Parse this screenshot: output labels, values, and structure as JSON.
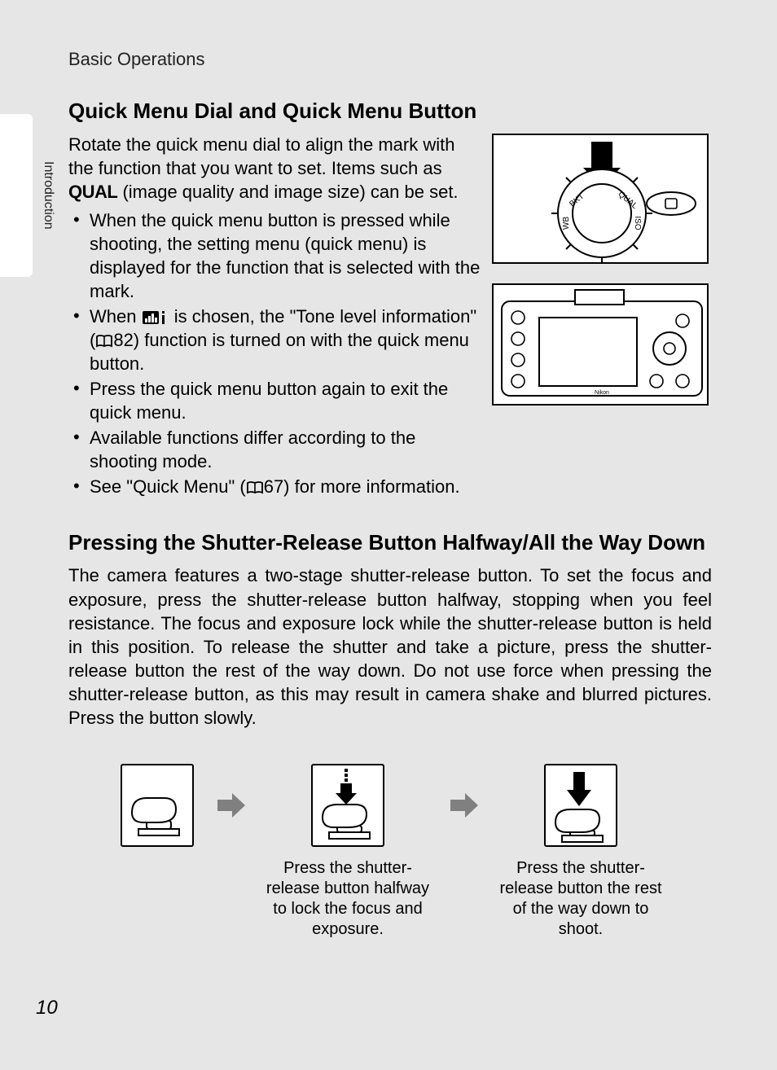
{
  "header": {
    "title": "Basic Operations"
  },
  "sideTab": {
    "label": "Introduction"
  },
  "section1": {
    "heading": "Quick Menu Dial and Quick Menu Button",
    "intro_a": "Rotate the quick menu dial to align the mark with the function that you want to set. Items such as ",
    "intro_qual": "QUAL",
    "intro_b": " (image quality and image size) can be set.",
    "bullets": {
      "b1": "When the quick menu button is pressed while shooting, the setting menu (quick menu) is displayed for the function that is selected with the mark.",
      "b2_a": "When ",
      "b2_b": " is chosen, the \"Tone level information\" (",
      "b2_c": "82) function is turned on with the quick menu button.",
      "b3": "Press the quick menu button again to exit the quick menu.",
      "b4": "Available functions differ according to the shooting mode.",
      "b5_a": "See \"Quick Menu\" (",
      "b5_b": "67) for more information."
    }
  },
  "section2": {
    "heading": "Pressing the Shutter-Release Button Halfway/All the Way Down",
    "body": "The camera features a two-stage shutter-release button. To set the focus and exposure, press the shutter-release button halfway, stopping when you feel resistance. The focus and exposure lock while the shutter-release button is held in this position. To release the shutter and take a picture, press the shutter-release button the rest of the way down. Do not use force when pressing the shutter-release button, as this may result in camera shake and blurred pictures. Press the button slowly.",
    "cap1": "Press the shutter-release button halfway to lock the focus and exposure.",
    "cap2": "Press the shutter-release button the rest of the way down to shoot."
  },
  "icons": {
    "qual": "QUAL",
    "tone": "tone-level-icon",
    "book": "page-ref-icon"
  },
  "pageNumber": "10"
}
